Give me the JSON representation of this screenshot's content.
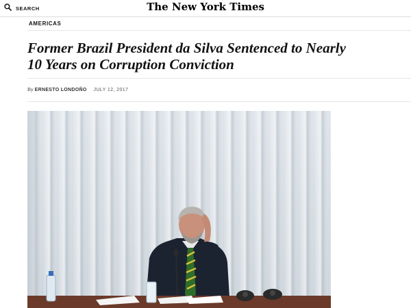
{
  "header": {
    "search_label": "SEARCH",
    "masthead": "The New York Times"
  },
  "article": {
    "section": "AMERICAS",
    "headline": "Former Brazil President da Silva Sentenced to Nearly 10 Years on Corruption Conviction",
    "byline_prefix": "By",
    "author": "ERNESTO LONDOÑO",
    "date": "JULY 12, 2017"
  },
  "colors": {
    "accent": "#121212",
    "rule": "#e6e6e6",
    "table": "#6b3a2a",
    "curtain": "#dfe5ea"
  },
  "icons": [
    "search-icon"
  ]
}
